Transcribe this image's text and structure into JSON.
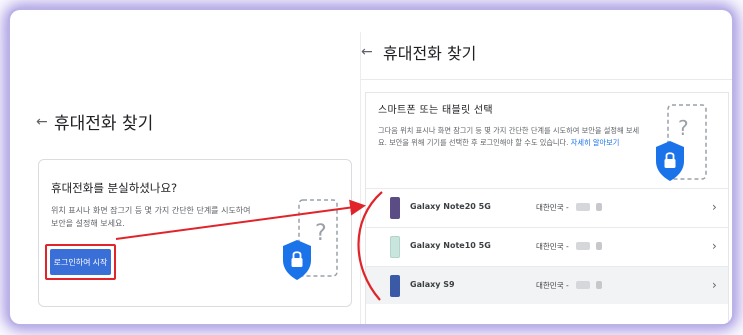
{
  "left": {
    "back_icon": "arrow-left-icon",
    "title": "휴대전화 찾기",
    "card": {
      "heading": "휴대전화를 분실하셨나요?",
      "description": "위치 표시나 화면 잠그기 등 몇 가지 간단한 단계를 시도하여 보안을 설정해 보세요.",
      "button_label": "로그인하여 시작",
      "illustration": "phone-shield-lock-icon"
    }
  },
  "right": {
    "back_icon": "arrow-left-icon",
    "title": "휴대전화 찾기",
    "card": {
      "heading": "스마트폰 또는 태블릿 선택",
      "description": "그다음 위치 표시나 화면 잠그기 등 몇 가지 간단한 단계를 시도하여 보안을 설정해 보세요. 보안을 위해 기기를 선택한 후 로그인해야 할 수도 있습니다.",
      "learn_more": "자세히 알아보기",
      "illustration": "phone-shield-question-icon"
    },
    "devices": [
      {
        "name": "Galaxy Note20 5G",
        "region": "대한민국 -",
        "thumb_color": "#5b4c86"
      },
      {
        "name": "Galaxy Note10 5G",
        "region": "대한민국 -",
        "thumb_color": "#c9e6de"
      },
      {
        "name": "Galaxy S9",
        "region": "대한민국 -",
        "thumb_color": "#3a5aa8"
      }
    ]
  },
  "colors": {
    "accent": "#3b6fd8",
    "annotation_red": "#e0242a",
    "shield_blue": "#1a73e8",
    "frame_glow": "#a89be0"
  }
}
